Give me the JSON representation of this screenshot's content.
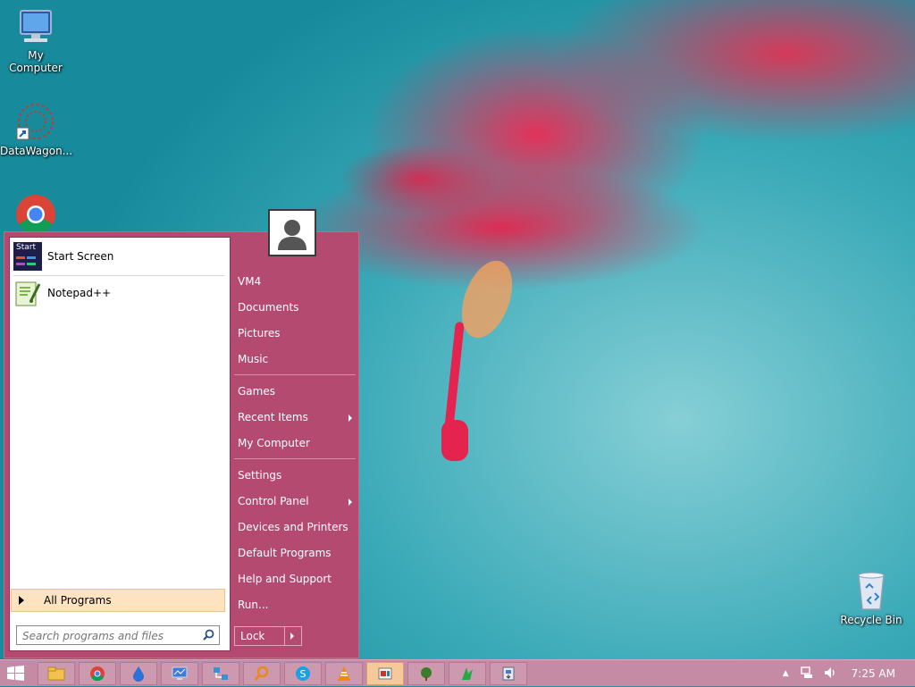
{
  "desktop": {
    "icons": [
      {
        "label": "My Computer"
      },
      {
        "label": "DataWagon..."
      },
      {
        "label": ""
      },
      {
        "label": "Recycle Bin"
      }
    ]
  },
  "start_menu": {
    "pinned": [
      {
        "label": "Start Screen",
        "badge": "Start"
      },
      {
        "label": "Notepad++"
      }
    ],
    "all_programs": "All Programs",
    "search_placeholder": "Search programs and files",
    "right_links": [
      {
        "label": "VM4"
      },
      {
        "label": "Documents"
      },
      {
        "label": "Pictures"
      },
      {
        "label": "Music"
      },
      {
        "label": "Games"
      },
      {
        "label": "Recent Items"
      },
      {
        "label": "My Computer"
      },
      {
        "label": "Settings"
      },
      {
        "label": "Control Panel"
      },
      {
        "label": "Devices and Printers"
      },
      {
        "label": "Default Programs"
      },
      {
        "label": "Help and Support"
      },
      {
        "label": "Run..."
      }
    ],
    "power_button": "Lock"
  },
  "taskbar": {
    "buttons": [
      "file-explorer-icon",
      "chrome-icon",
      "drop-icon",
      "monitor-icon",
      "network-app-icon",
      "search-app-icon",
      "skype-icon",
      "vlc-icon",
      "app-icon",
      "tree-app-icon",
      "green-arrow-icon",
      "installer-icon"
    ],
    "active_index": 8,
    "clock": "7:25 AM"
  },
  "colors": {
    "menu_bg": "#b44a70",
    "taskbar_bg": "#c58ba4",
    "highlight": "#fde3c0",
    "wallpaper_teal": "#39a9b7",
    "flower_red": "#e4244f"
  }
}
